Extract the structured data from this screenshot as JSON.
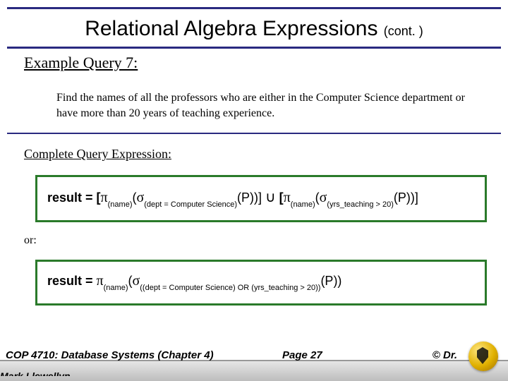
{
  "title_main": "Relational Algebra Expressions ",
  "title_cont": "(cont. )",
  "example_heading": "Example Query 7:",
  "problem_text": "Find the names of all the professors who are either in the Computer Science department or have more than 20 years of teaching experience.",
  "complete_label": "Complete Query Expression:",
  "expr1": {
    "lead": "result = [",
    "pi1": "π",
    "pi1_sub": "(name)",
    "open1": "(",
    "sigma1": "σ",
    "sigma1_sub": "(dept = Computer Science)",
    "tail1": "(P))] ",
    "cup": "∪",
    "mid": " [",
    "pi2": "π",
    "pi2_sub": "(name)",
    "open2": "(",
    "sigma2": "σ",
    "sigma2_sub": "(yrs_teaching > 20)",
    "tail2": "(P))]"
  },
  "or_label": "or:",
  "expr2": {
    "lead": "result = ",
    "pi": "π",
    "pi_sub": "(name)",
    "open": "(",
    "sigma": "σ",
    "sigma_sub": "((dept = Computer Science) OR (yrs_teaching > 20))",
    "tail": "(P))"
  },
  "footer": {
    "course": "COP 4710: Database Systems  (Chapter 4)",
    "page": "Page 27",
    "copyright": "© Dr.",
    "author_cut": "Mark Llewellyn"
  }
}
